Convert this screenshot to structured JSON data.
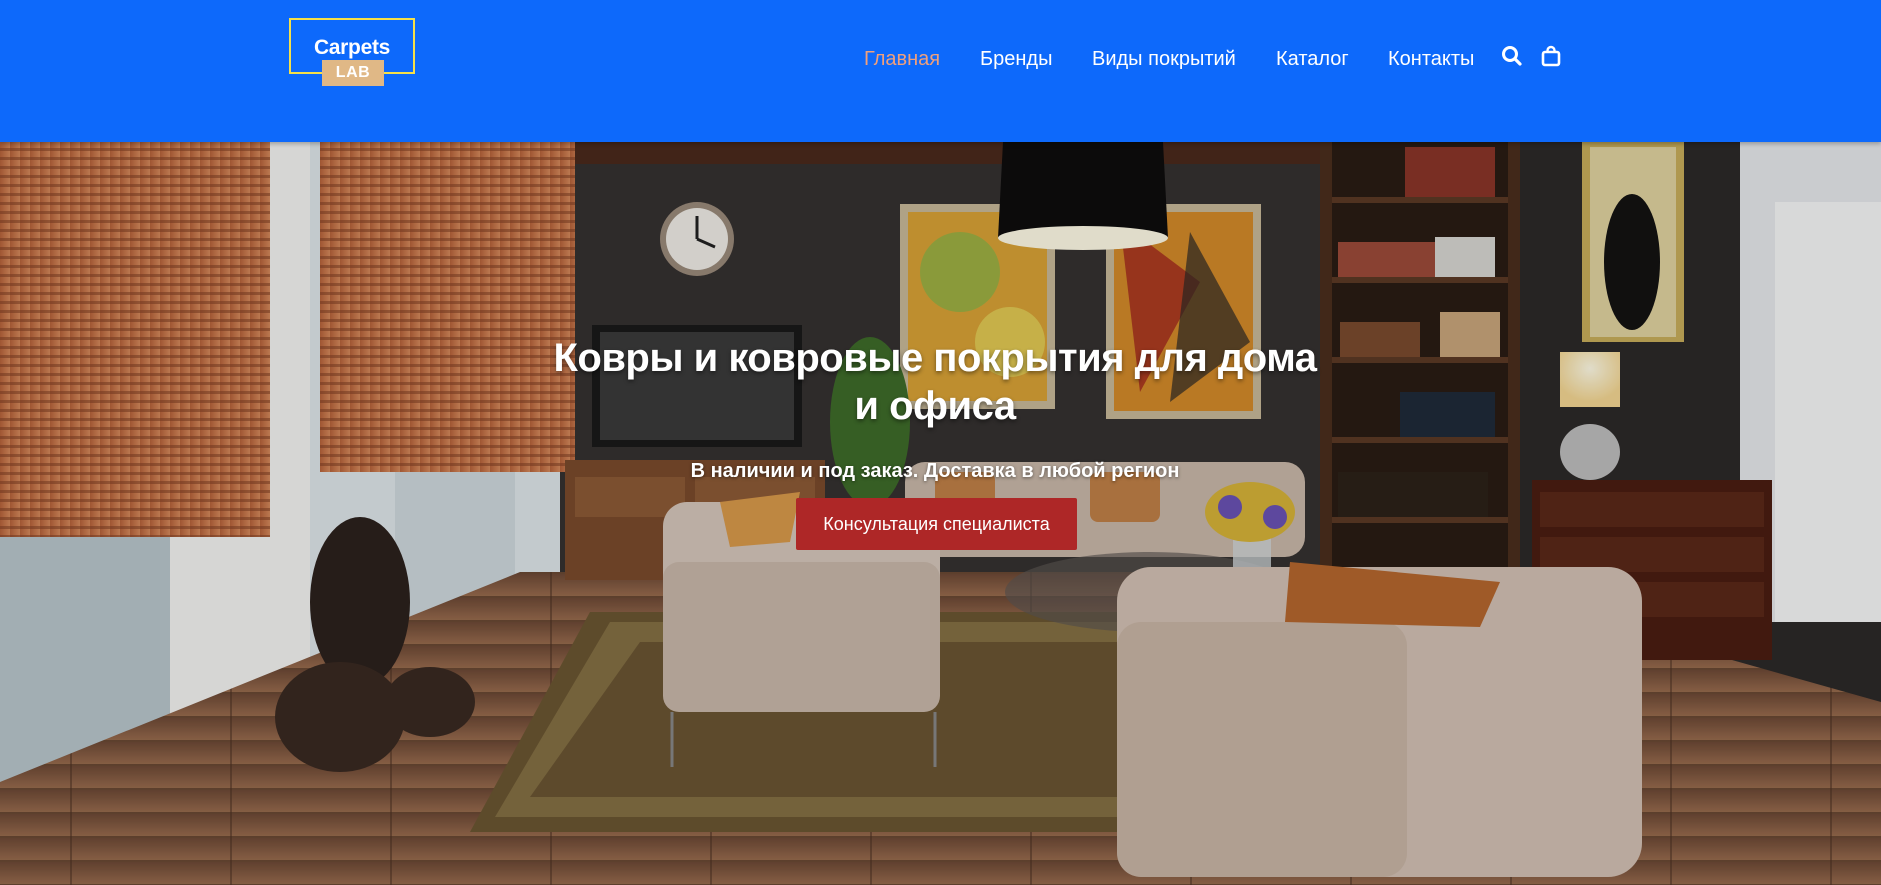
{
  "logo": {
    "word": "Carpets",
    "tag": "LAB"
  },
  "nav": {
    "items": [
      {
        "label": "Главная",
        "active": true
      },
      {
        "label": "Бренды",
        "active": false
      },
      {
        "label": "Виды покрытий",
        "active": false
      },
      {
        "label": "Каталог",
        "active": false
      },
      {
        "label": "Контакты",
        "active": false
      }
    ],
    "icons": [
      "search-icon",
      "shopping-bag-icon"
    ]
  },
  "hero": {
    "title": "Ковры и ковровые покрытия для дома и офиса",
    "subtitle": "В наличии и под заказ. Доставка в любой регион",
    "cta_label": "Консультация специалиста"
  },
  "colors": {
    "header_bg": "#0d69fb",
    "nav_active": "#f0a07c",
    "logo_border": "#f4e04a",
    "logo_tag_bg": "#e0b886",
    "cta_bg": "#ae2727"
  }
}
